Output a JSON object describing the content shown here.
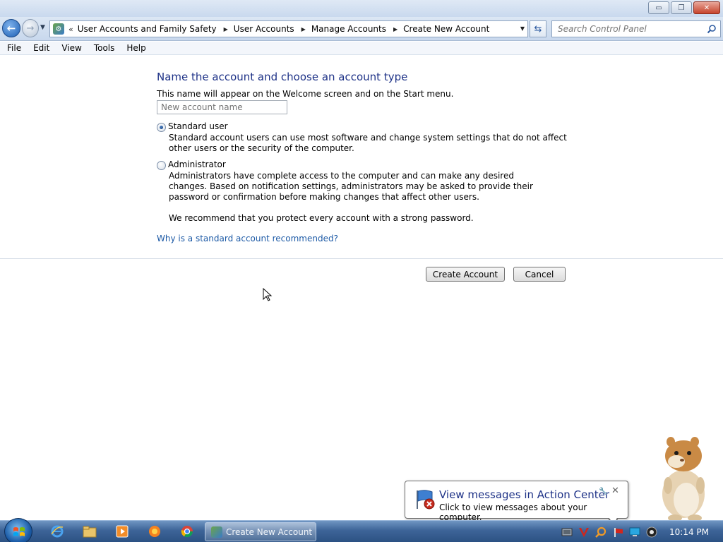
{
  "window": {
    "minimize_glyph": "▭",
    "maximize_glyph": "❐",
    "close_glyph": "✕"
  },
  "navigation": {
    "back_glyph": "←",
    "forward_glyph": "→",
    "history_glyph": "▼",
    "address_icon": "control-panel-icon",
    "breadcrumb_overflow": "«",
    "breadcrumbs": [
      "User Accounts and Family Safety",
      "User Accounts",
      "Manage Accounts",
      "Create New Account"
    ],
    "address_dropdown_glyph": "▼",
    "refresh_glyph": "⇆",
    "search_placeholder": "Search Control Panel"
  },
  "menu": [
    "File",
    "Edit",
    "View",
    "Tools",
    "Help"
  ],
  "form": {
    "heading": "Name the account and choose an account type",
    "subtext": "This name will appear on the Welcome screen and on the Start menu.",
    "name_placeholder": "New account name",
    "options": [
      {
        "label": "Standard user",
        "selected": true,
        "description": "Standard account users can use most software and change system settings that do not affect other users or the security of the computer."
      },
      {
        "label": "Administrator",
        "selected": false,
        "description": "Administrators have complete access to the computer and can make any desired changes. Based on notification settings, administrators may be asked to provide their password or confirmation before making changes that affect other users."
      }
    ],
    "recommendation": "We recommend that you protect every account with a strong password.",
    "help_link": "Why is a standard account recommended?",
    "create_button": "Create Account",
    "cancel_button": "Cancel"
  },
  "notification": {
    "title": "View messages in Action Center",
    "text": "Click to view messages about your computer.",
    "pin_glyph": "🔧",
    "close_glyph": "✕"
  },
  "taskbar": {
    "pinned": [
      "internet-explorer-icon",
      "file-explorer-icon",
      "media-player-icon",
      "firefox-icon",
      "chrome-icon"
    ],
    "active_task": "Create New Account",
    "tray": [
      "network-icon",
      "antivirus-icon",
      "search-tray-icon",
      "action-center-flag-icon",
      "display-icon",
      "volume-icon"
    ],
    "clock": "10:14 PM"
  }
}
